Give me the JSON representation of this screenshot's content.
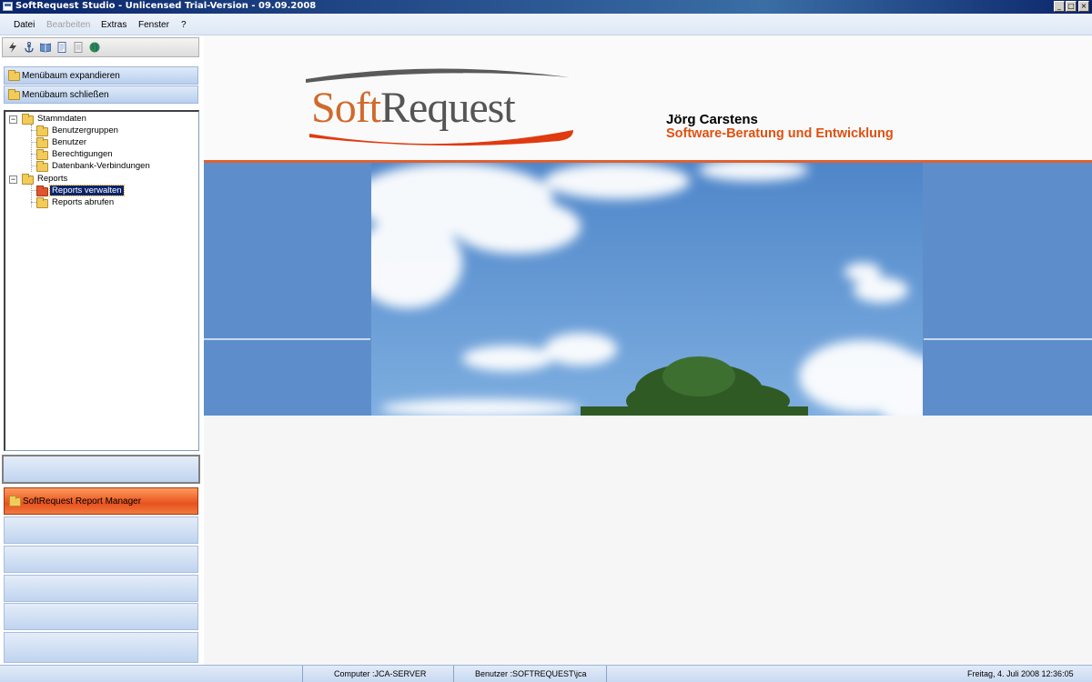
{
  "window": {
    "title": "SoftRequest Studio - Unlicensed Trial-Version - 09.09.2008"
  },
  "menu": {
    "items": [
      {
        "label": "Datei",
        "enabled": true
      },
      {
        "label": "Bearbeiten",
        "enabled": false
      },
      {
        "label": "Extras",
        "enabled": true
      },
      {
        "label": "Fenster",
        "enabled": true
      },
      {
        "label": "?",
        "enabled": true
      }
    ]
  },
  "toolbar": {
    "icons": [
      "lightning-icon",
      "anchor-icon",
      "book-icon",
      "document-icon",
      "page-icon",
      "globe-icon"
    ]
  },
  "sidebar": {
    "expand_label": "Menübaum expandieren",
    "collapse_label": "Menübaum schließen",
    "tree": [
      {
        "label": "Stammdaten",
        "level": 0,
        "expanded": true
      },
      {
        "label": "Benutzergruppen",
        "level": 1
      },
      {
        "label": "Benutzer",
        "level": 1
      },
      {
        "label": "Berechtigungen",
        "level": 1
      },
      {
        "label": "Datenbank-Verbindungen",
        "level": 1
      },
      {
        "label": "Reports",
        "level": 0,
        "expanded": true
      },
      {
        "label": "Reports verwalten",
        "level": 1,
        "selected": true
      },
      {
        "label": "Reports abrufen",
        "level": 1
      }
    ],
    "report_manager_label": "SoftRequest Report Manager"
  },
  "header": {
    "logo_soft": "Soft",
    "logo_request": "Request",
    "name": "Jörg Carstens",
    "tagline": "Software-Beratung und Entwicklung"
  },
  "status": {
    "computer": "Computer :JCA-SERVER",
    "user": "Benutzer :SOFTREQUEST\\jca",
    "datetime": "Freitag, 4. Juli 2008 12:36:05"
  },
  "colors": {
    "title_bar": "#0a246a",
    "accent_orange": "#e05010",
    "panel_blue": "#5d8ecb",
    "selection": "#0a246a"
  }
}
